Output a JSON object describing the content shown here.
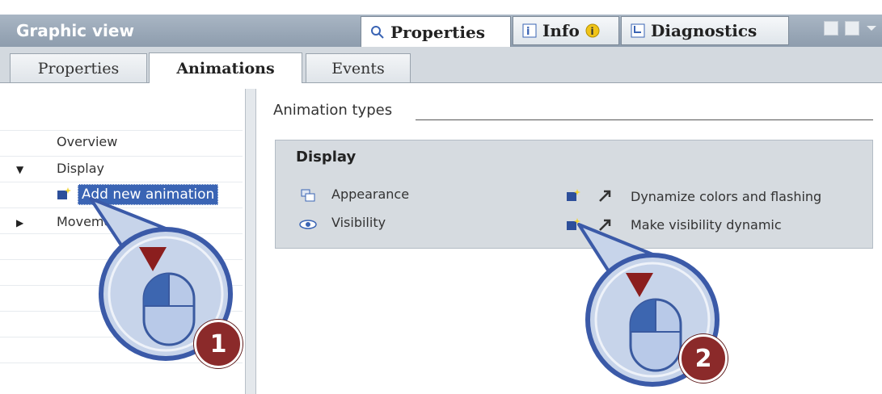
{
  "header": {
    "title": "Graphic view",
    "tabs": [
      {
        "label": "Properties",
        "icon": "properties-icon"
      },
      {
        "label": "Info",
        "icon": "info-icon"
      },
      {
        "label": "Diagnostics",
        "icon": "diagnostics-icon"
      }
    ]
  },
  "subtabs": [
    "Properties",
    "Animations",
    "Events"
  ],
  "nav": {
    "overview": "Overview",
    "display": "Display",
    "add_new": "Add new animation",
    "movements": "Movements"
  },
  "main": {
    "section_label": "Animation types",
    "display": {
      "heading": "Display",
      "types": [
        {
          "label": "Appearance",
          "icon": "appearance-icon"
        },
        {
          "label": "Visibility",
          "icon": "eye-icon"
        }
      ],
      "actions": [
        {
          "label": "Dynamize colors and flashing",
          "icon": "add-animation-icon"
        },
        {
          "label": "Make visibility dynamic",
          "icon": "add-animation-icon"
        }
      ]
    }
  },
  "callouts": [
    "1",
    "2"
  ],
  "colors": {
    "selection": "#3a64b4",
    "header": "#8d9cad",
    "callout_ring": "#3b5aa8",
    "badge": "#8b2a2a"
  }
}
